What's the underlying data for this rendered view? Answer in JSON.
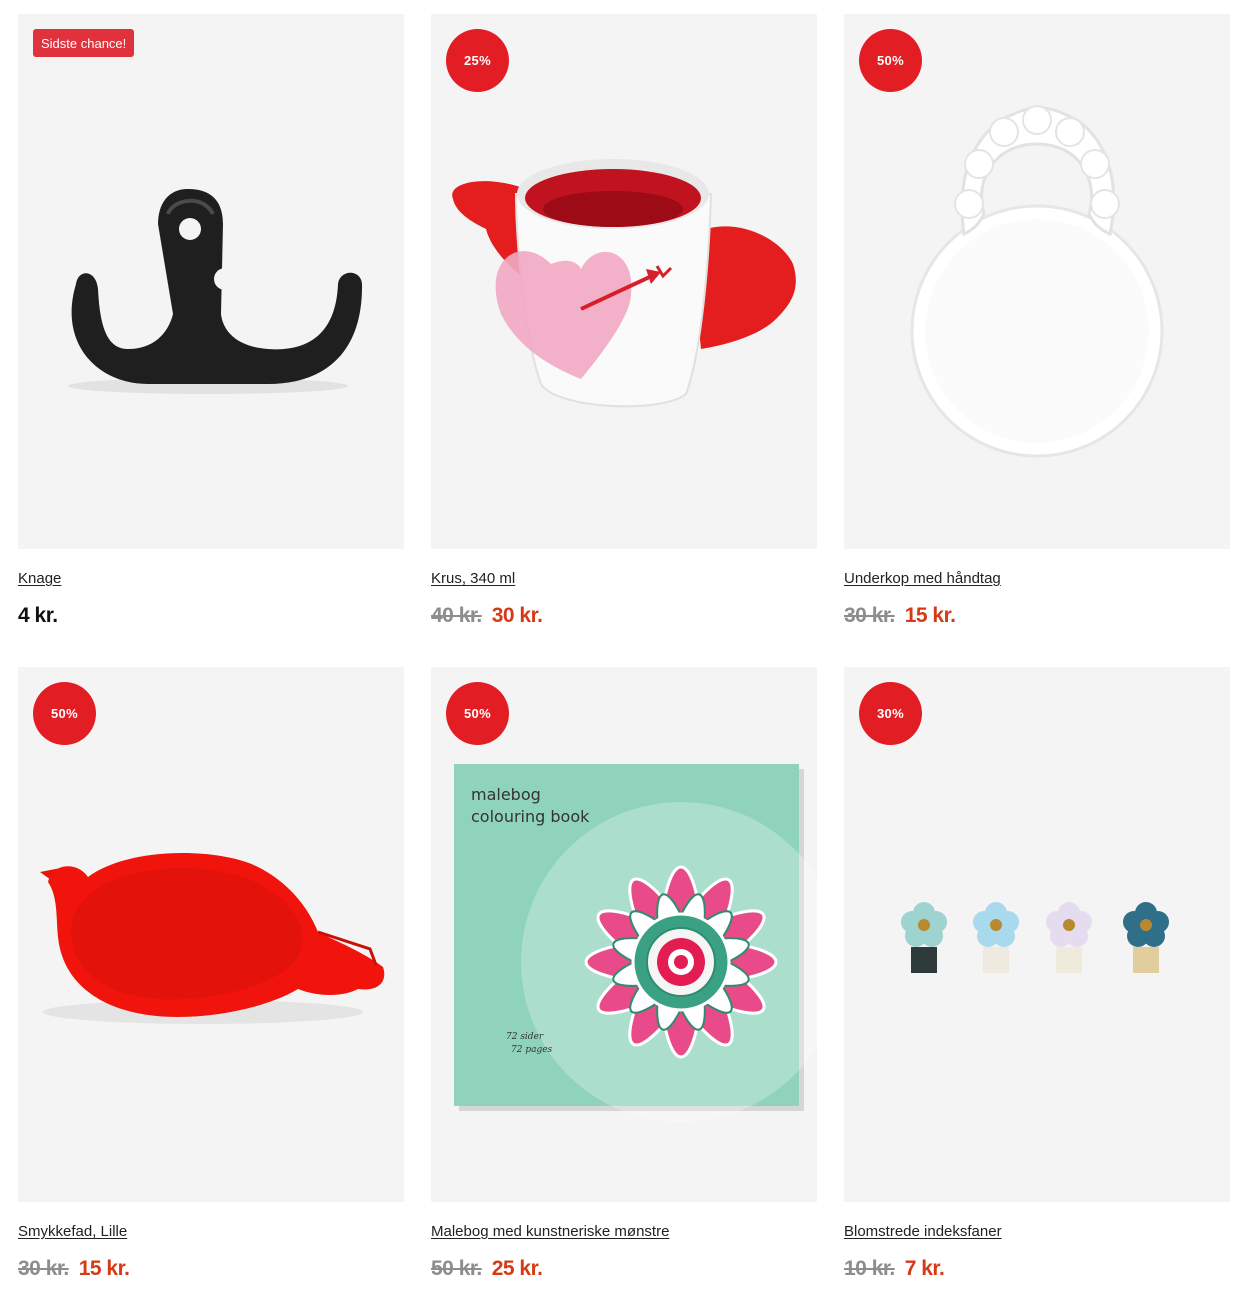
{
  "products": [
    {
      "name": "Knage",
      "badge": "Sidste chance!",
      "badge_type": "tag",
      "price_old": "",
      "price": "4 kr.",
      "image": "black-double-hook"
    },
    {
      "name": "Krus, 340 ml",
      "badge": "25%",
      "badge_type": "circle",
      "price_old": "40 kr.",
      "price": "30 kr.",
      "image": "winged-heart-mug"
    },
    {
      "name": "Underkop med håndtag",
      "badge": "50%",
      "badge_type": "circle",
      "price_old": "30 kr.",
      "price": "15 kr.",
      "image": "white-round-saucer-with-handle"
    },
    {
      "name": "Smykkefad, Lille",
      "badge": "50%",
      "badge_type": "circle",
      "price_old": "30 kr.",
      "price": "15 kr.",
      "image": "red-heart-arrow-dish"
    },
    {
      "name": "Malebog med kunstneriske mønstre",
      "badge": "50%",
      "badge_type": "circle",
      "price_old": "50 kr.",
      "price": "25 kr.",
      "image": "mandala-colouring-book",
      "cover": {
        "title_1": "malebog",
        "title_2": "colouring book",
        "pages_1": "72 sider",
        "pages_2": "72 pages"
      }
    },
    {
      "name": "Blomstrede indeksfaner",
      "badge": "30%",
      "badge_type": "circle",
      "price_old": "10 kr.",
      "price": "7 kr.",
      "image": "flower-index-tabs"
    }
  ],
  "colors": {
    "badge_red": "#e31d24",
    "sale_price": "#d63a14",
    "old_price": "#8d8d8d",
    "image_bg": "#f4f4f4"
  }
}
